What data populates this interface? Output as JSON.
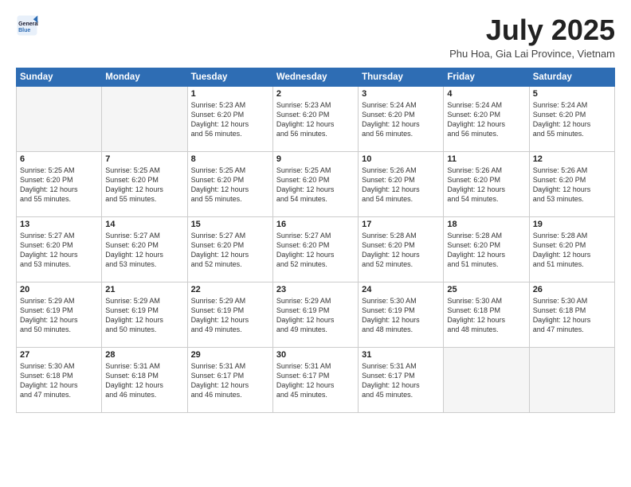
{
  "logo": {
    "line1": "General",
    "line2": "Blue"
  },
  "title": "July 2025",
  "subtitle": "Phu Hoa, Gia Lai Province, Vietnam",
  "days_of_week": [
    "Sunday",
    "Monday",
    "Tuesday",
    "Wednesday",
    "Thursday",
    "Friday",
    "Saturday"
  ],
  "weeks": [
    [
      {
        "day": "",
        "info": ""
      },
      {
        "day": "",
        "info": ""
      },
      {
        "day": "1",
        "info": "Sunrise: 5:23 AM\nSunset: 6:20 PM\nDaylight: 12 hours\nand 56 minutes."
      },
      {
        "day": "2",
        "info": "Sunrise: 5:23 AM\nSunset: 6:20 PM\nDaylight: 12 hours\nand 56 minutes."
      },
      {
        "day": "3",
        "info": "Sunrise: 5:24 AM\nSunset: 6:20 PM\nDaylight: 12 hours\nand 56 minutes."
      },
      {
        "day": "4",
        "info": "Sunrise: 5:24 AM\nSunset: 6:20 PM\nDaylight: 12 hours\nand 56 minutes."
      },
      {
        "day": "5",
        "info": "Sunrise: 5:24 AM\nSunset: 6:20 PM\nDaylight: 12 hours\nand 55 minutes."
      }
    ],
    [
      {
        "day": "6",
        "info": "Sunrise: 5:25 AM\nSunset: 6:20 PM\nDaylight: 12 hours\nand 55 minutes."
      },
      {
        "day": "7",
        "info": "Sunrise: 5:25 AM\nSunset: 6:20 PM\nDaylight: 12 hours\nand 55 minutes."
      },
      {
        "day": "8",
        "info": "Sunrise: 5:25 AM\nSunset: 6:20 PM\nDaylight: 12 hours\nand 55 minutes."
      },
      {
        "day": "9",
        "info": "Sunrise: 5:25 AM\nSunset: 6:20 PM\nDaylight: 12 hours\nand 54 minutes."
      },
      {
        "day": "10",
        "info": "Sunrise: 5:26 AM\nSunset: 6:20 PM\nDaylight: 12 hours\nand 54 minutes."
      },
      {
        "day": "11",
        "info": "Sunrise: 5:26 AM\nSunset: 6:20 PM\nDaylight: 12 hours\nand 54 minutes."
      },
      {
        "day": "12",
        "info": "Sunrise: 5:26 AM\nSunset: 6:20 PM\nDaylight: 12 hours\nand 53 minutes."
      }
    ],
    [
      {
        "day": "13",
        "info": "Sunrise: 5:27 AM\nSunset: 6:20 PM\nDaylight: 12 hours\nand 53 minutes."
      },
      {
        "day": "14",
        "info": "Sunrise: 5:27 AM\nSunset: 6:20 PM\nDaylight: 12 hours\nand 53 minutes."
      },
      {
        "day": "15",
        "info": "Sunrise: 5:27 AM\nSunset: 6:20 PM\nDaylight: 12 hours\nand 52 minutes."
      },
      {
        "day": "16",
        "info": "Sunrise: 5:27 AM\nSunset: 6:20 PM\nDaylight: 12 hours\nand 52 minutes."
      },
      {
        "day": "17",
        "info": "Sunrise: 5:28 AM\nSunset: 6:20 PM\nDaylight: 12 hours\nand 52 minutes."
      },
      {
        "day": "18",
        "info": "Sunrise: 5:28 AM\nSunset: 6:20 PM\nDaylight: 12 hours\nand 51 minutes."
      },
      {
        "day": "19",
        "info": "Sunrise: 5:28 AM\nSunset: 6:20 PM\nDaylight: 12 hours\nand 51 minutes."
      }
    ],
    [
      {
        "day": "20",
        "info": "Sunrise: 5:29 AM\nSunset: 6:19 PM\nDaylight: 12 hours\nand 50 minutes."
      },
      {
        "day": "21",
        "info": "Sunrise: 5:29 AM\nSunset: 6:19 PM\nDaylight: 12 hours\nand 50 minutes."
      },
      {
        "day": "22",
        "info": "Sunrise: 5:29 AM\nSunset: 6:19 PM\nDaylight: 12 hours\nand 49 minutes."
      },
      {
        "day": "23",
        "info": "Sunrise: 5:29 AM\nSunset: 6:19 PM\nDaylight: 12 hours\nand 49 minutes."
      },
      {
        "day": "24",
        "info": "Sunrise: 5:30 AM\nSunset: 6:19 PM\nDaylight: 12 hours\nand 48 minutes."
      },
      {
        "day": "25",
        "info": "Sunrise: 5:30 AM\nSunset: 6:18 PM\nDaylight: 12 hours\nand 48 minutes."
      },
      {
        "day": "26",
        "info": "Sunrise: 5:30 AM\nSunset: 6:18 PM\nDaylight: 12 hours\nand 47 minutes."
      }
    ],
    [
      {
        "day": "27",
        "info": "Sunrise: 5:30 AM\nSunset: 6:18 PM\nDaylight: 12 hours\nand 47 minutes."
      },
      {
        "day": "28",
        "info": "Sunrise: 5:31 AM\nSunset: 6:18 PM\nDaylight: 12 hours\nand 46 minutes."
      },
      {
        "day": "29",
        "info": "Sunrise: 5:31 AM\nSunset: 6:17 PM\nDaylight: 12 hours\nand 46 minutes."
      },
      {
        "day": "30",
        "info": "Sunrise: 5:31 AM\nSunset: 6:17 PM\nDaylight: 12 hours\nand 45 minutes."
      },
      {
        "day": "31",
        "info": "Sunrise: 5:31 AM\nSunset: 6:17 PM\nDaylight: 12 hours\nand 45 minutes."
      },
      {
        "day": "",
        "info": ""
      },
      {
        "day": "",
        "info": ""
      }
    ]
  ]
}
